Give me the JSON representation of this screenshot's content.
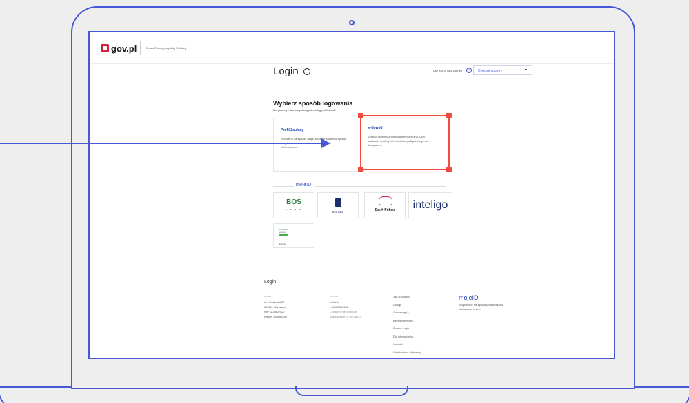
{
  "header": {
    "brand": "gov.pl",
    "service": "Serwis Rzeczypospolitej Polskiej"
  },
  "login": {
    "title": "Login",
    "country_label": "Use eID of your country",
    "country_select": "Choose country"
  },
  "method": {
    "title": "Wybierz sposób logowania",
    "subtitle": "Bezpieczny i darmowy dostęp do usług publicznych"
  },
  "cards": [
    {
      "title": "Profil Zaufany",
      "desc": "Bezpłatne narzędzie, dzięki któremu załatwisz sprawy urzędowe online i podpiszesz dokumenty elektroniczne."
    },
    {
      "title": "e-dowód",
      "desc": "Dowód osobisty z warstwą elektroniczną. Użyj aplikacji mobilnej albo czytnika podłączonego do komputera."
    }
  ],
  "mojeid": {
    "label": "mojeID"
  },
  "banks": {
    "bos": "BOŚ",
    "pko": "Bank Polski",
    "pekao": "Bank Pekao",
    "inteligo": "inteligo",
    "envelo_brand": "Pocztowy envelo",
    "envelo_label": "Envelo"
  },
  "footer": {
    "title": "Login",
    "address_head": "Adres",
    "address": [
      "ul. Królewska 27",
      "00-060 Warszawa",
      "NIP 5213627827",
      "Regon 140891480"
    ],
    "contact_head": "Kontakt",
    "contact": [
      "infolinia",
      "+48422535486"
    ],
    "contact_note": [
      "Czynna w dni robocze",
      "w godzinach 07:00-18:00"
    ],
    "links": [
      "Jak korzystać",
      "Usługi",
      "Co nowego?",
      "Bezpieczeństwo",
      "Pomoc Login",
      "Dla integratorów",
      "Kontakt",
      "Ministerstwo Cyfryzacji"
    ],
    "mojeid": "mojeID",
    "mojeid_desc": "Bezpieczne narzędzie potwierdzania tożsamości online"
  },
  "colors": {
    "accent": "#4658d6",
    "highlight": "#f14c3e",
    "gov_red": "#d4213d"
  }
}
